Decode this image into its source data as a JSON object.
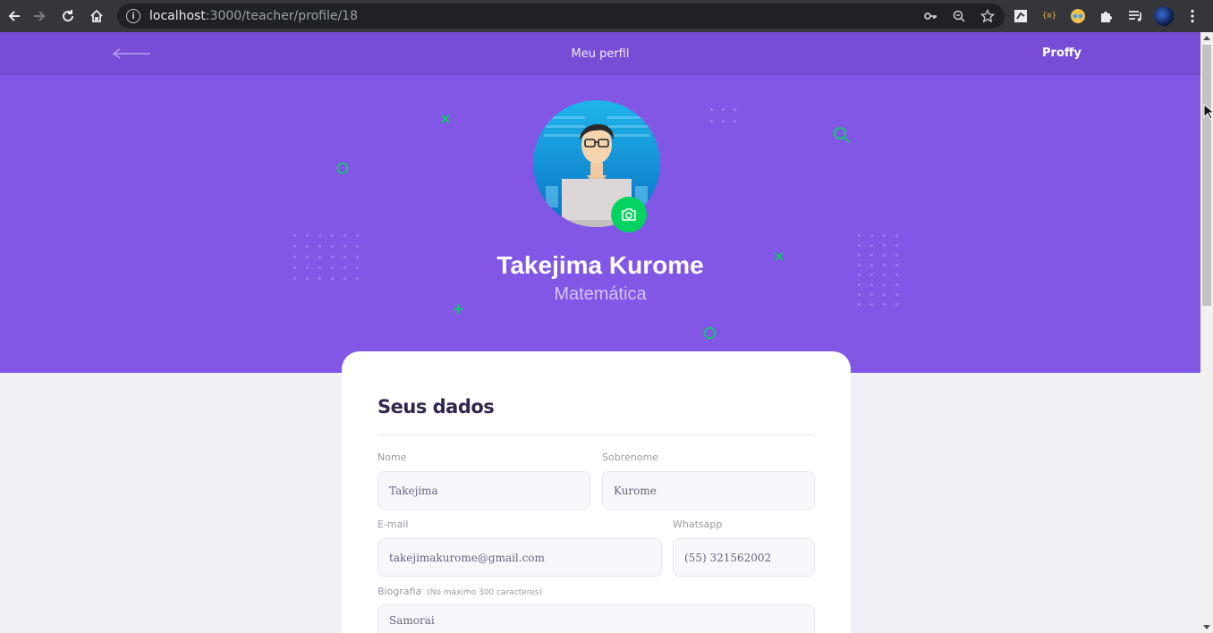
{
  "browser": {
    "url_host": "localhost",
    "url_path": ":3000/teacher/profile/18",
    "icons": [
      "back-icon",
      "forward-icon",
      "reload-icon",
      "home-icon",
      "info-icon",
      "key-icon",
      "zoom-icon",
      "star-icon",
      "extension-icon",
      "puzzle-icon",
      "media-icon",
      "profile-avatar",
      "menu-icon"
    ]
  },
  "topbar": {
    "title": "Meu perfil",
    "brand": "Proffy"
  },
  "profile": {
    "name": "Takejima Kurome",
    "subject": "Matemática"
  },
  "form": {
    "title": "Seus dados",
    "first_name_label": "Nome",
    "first_name_value": "Takejima",
    "last_name_label": "Sobrenome",
    "last_name_value": "Kurome",
    "email_label": "E-mail",
    "email_value": "takejimakurome@gmail.com",
    "whatsapp_label": "Whatsapp",
    "whatsapp_value": "(55) 321562002",
    "bio_label": "Biografia",
    "bio_hint": "(No máximo 300 caracteres)",
    "bio_value": "Samorai"
  },
  "colors": {
    "primary": "#8257e5",
    "primary_dark": "#774dd6",
    "secondary": "#04d361",
    "title": "#32264d"
  }
}
